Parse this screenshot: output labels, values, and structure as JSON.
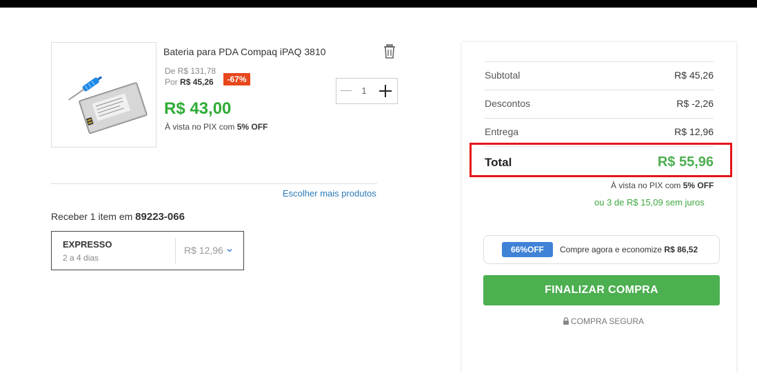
{
  "product": {
    "name": "Bateria para PDA Compaq iPAQ 3810",
    "old_price": "De R$ 131,78",
    "por_label": "Por",
    "por_price": "R$ 45,26",
    "discount": "-67%",
    "pix_price": "R$ 43,00",
    "pix_note_prefix": "À vista no PIX com",
    "pix_note_discount": "5% OFF",
    "quantity": "1",
    "image_icon": "battery-product-image"
  },
  "links": {
    "more_products": "Escolher mais produtos"
  },
  "delivery": {
    "prefix": "Receber 1 item em",
    "zip": "89223-066",
    "option_name": "EXPRESSO",
    "option_days": "2 a 4 dias",
    "option_price": "R$ 12,96"
  },
  "summary": {
    "subtotal_label": "Subtotal",
    "subtotal_value": "R$ 45,26",
    "discounts_label": "Descontos",
    "discounts_value": "R$ -2,26",
    "shipping_label": "Entrega",
    "shipping_value": "R$ 12,96",
    "total_label": "Total",
    "total_value": "R$ 55,96",
    "pix_prefix": "À vista no PIX com",
    "pix_discount": "5% OFF",
    "installments": "ou 3 de R$ 15,09 sem juros"
  },
  "promo": {
    "badge": "66%OFF",
    "text_prefix": "Compre agora e economize",
    "text_value": "R$ 86,52"
  },
  "checkout": {
    "button_label": "FINALIZAR COMPRA",
    "secure_label": "COMPRA SEGURA"
  },
  "colors": {
    "price_green": "#2eac35",
    "discount_badge": "#e8471c",
    "checkout_green": "#4caf50",
    "promo_blue": "#3f82d6",
    "highlight_red": "#e5141a",
    "link_blue": "#2a7ab8"
  }
}
